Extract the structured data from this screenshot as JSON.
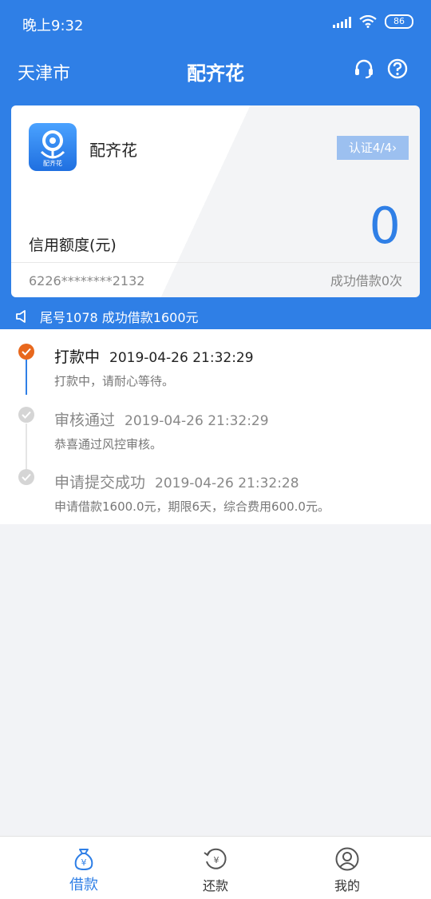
{
  "status_bar": {
    "time": "晚上9:32",
    "battery": "86"
  },
  "nav": {
    "city": "天津市",
    "title": "配齐花"
  },
  "card": {
    "logo_text": "配齐花",
    "app_name": "配齐花",
    "auth_badge": "认证4/4",
    "credit_label": "信用额度(元)",
    "credit_value": "0",
    "card_number": "6226********2132",
    "success_count": "成功借款0次"
  },
  "notice": {
    "text": "尾号1078 成功借款1600元"
  },
  "timeline": [
    {
      "title": "打款中",
      "time": "2019-04-26 21:32:29",
      "desc": "打款中，请耐心等待。"
    },
    {
      "title": "审核通过",
      "time": "2019-04-26 21:32:29",
      "desc": "恭喜通过风控审核。"
    },
    {
      "title": "申请提交成功",
      "time": "2019-04-26 21:32:28",
      "desc": "申请借款1600.0元，期限6天，综合费用600.0元。"
    }
  ],
  "tabs": [
    {
      "label": "借款",
      "icon": "money-bag-icon"
    },
    {
      "label": "还款",
      "icon": "repay-icon"
    },
    {
      "label": "我的",
      "icon": "user-icon"
    }
  ],
  "colors": {
    "primary": "#2f7fe6",
    "active_step": "#e8681d",
    "inactive_step": "#d5d5d5"
  }
}
